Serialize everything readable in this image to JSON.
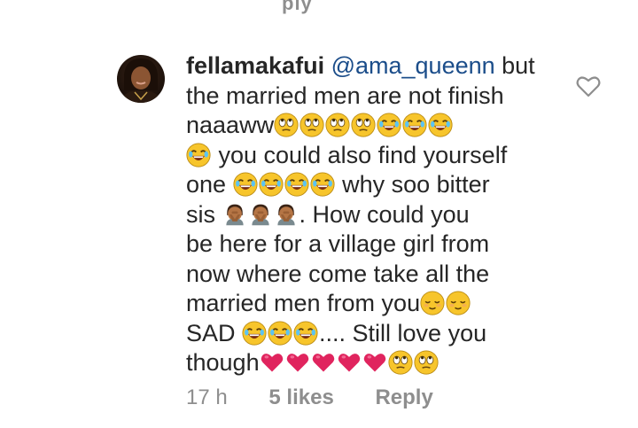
{
  "top_fragment": "ply",
  "comment": {
    "username": "fellamakafui",
    "mention": "@ama_queenn",
    "lines": [
      " but",
      "the married men are not finish",
      "naaaww",
      " you could also find yourself",
      "one ",
      " why soo bitter",
      "sis ",
      ". How could you",
      "be here for a village girl from",
      "now where come  take all the",
      "married men from you",
      "SAD ",
      ".... Still love you",
      "though"
    ]
  },
  "meta": {
    "time": "17 h",
    "likes": "5 likes",
    "reply": "Reply"
  },
  "icons": {
    "like_button": "heart-outline-icon",
    "avatar": "profile-avatar"
  },
  "colors": {
    "text": "#262626",
    "mention": "#1b4d8a",
    "meta": "#8e8e8e",
    "heart": "#e0245e"
  }
}
